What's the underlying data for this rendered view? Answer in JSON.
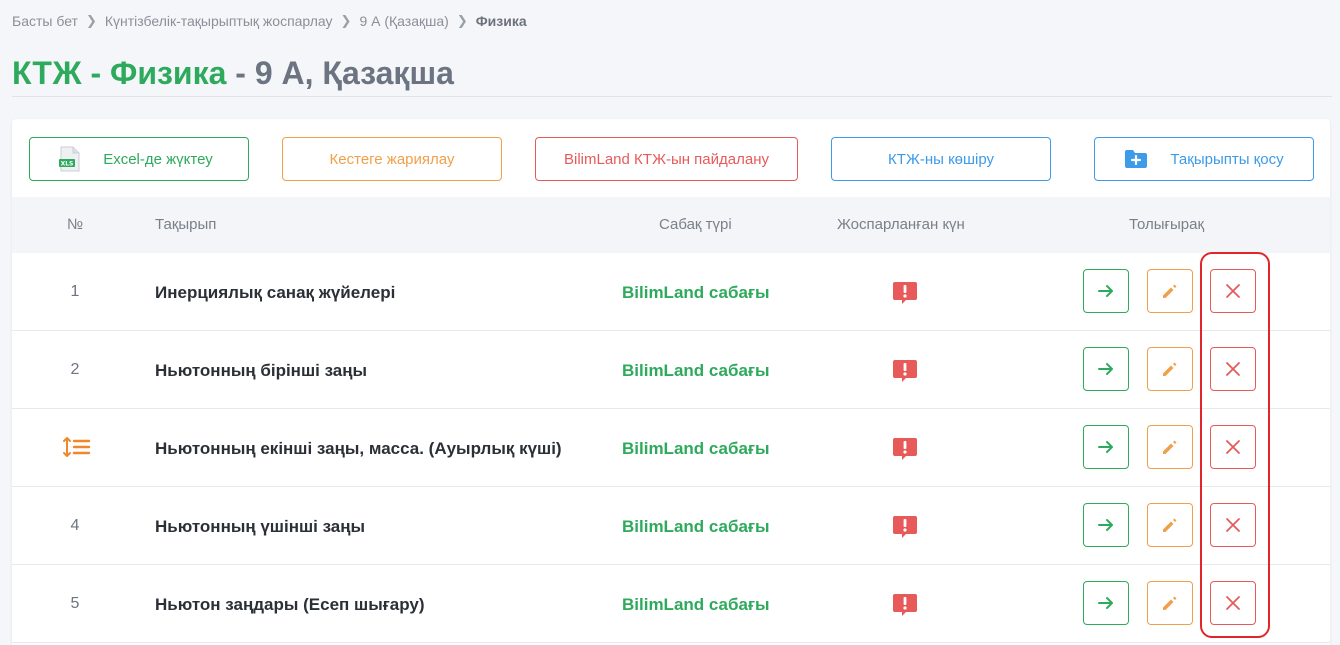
{
  "breadcrumb": {
    "items": [
      "Басты бет",
      "Күнтізбелік-тақырыптық жоспарлау",
      "9 А (Қазақша)"
    ],
    "current": "Физика"
  },
  "page": {
    "title_main": "КТЖ - Физика",
    "title_sub": " - 9 А, Қазақша"
  },
  "toolbar": {
    "excel_label": "Excel-де жүктеу",
    "publish_label": "Кестеге жариялау",
    "bilimland_label": "BilimLand КТЖ-ын пайдалану",
    "copy_label": "КТЖ-ны көшіру",
    "add_topic_label": "Тақырыпты қосу"
  },
  "table": {
    "headers": {
      "num": "№",
      "topic": "Тақырып",
      "type": "Сабақ түрі",
      "date": "Жоспарланған күн",
      "more": "Толығырақ"
    },
    "rows": [
      {
        "num": "1",
        "topic": "Инерциялық санақ жүйелері",
        "type": "BilimLand сабағы",
        "reorder": false
      },
      {
        "num": "2",
        "topic": "Ньютонның бірінші заңы",
        "type": "BilimLand сабағы",
        "reorder": false
      },
      {
        "num": "",
        "topic": "Ньютонның екінші заңы, масса. (Ауырлық күші)",
        "type": "BilimLand сабағы",
        "reorder": true
      },
      {
        "num": "4",
        "topic": "Ньютонның үшінші заңы",
        "type": "BilimLand сабағы",
        "reorder": false
      },
      {
        "num": "5",
        "topic": "Ньютон заңдары (Есеп шығару)",
        "type": "BilimLand сабағы",
        "reorder": false
      }
    ]
  },
  "colors": {
    "green": "#2eaa5c",
    "orange": "#f0a04b",
    "red": "#e85a5a",
    "blue": "#3d9be9",
    "highlight": "#e0262a"
  },
  "icons": {
    "excel": "xls-file-icon",
    "add": "folder-plus-icon",
    "warning": "alert-bubble-icon",
    "go": "arrow-right-icon",
    "edit": "pencil-icon",
    "delete": "close-icon",
    "reorder": "reorder-icon"
  }
}
